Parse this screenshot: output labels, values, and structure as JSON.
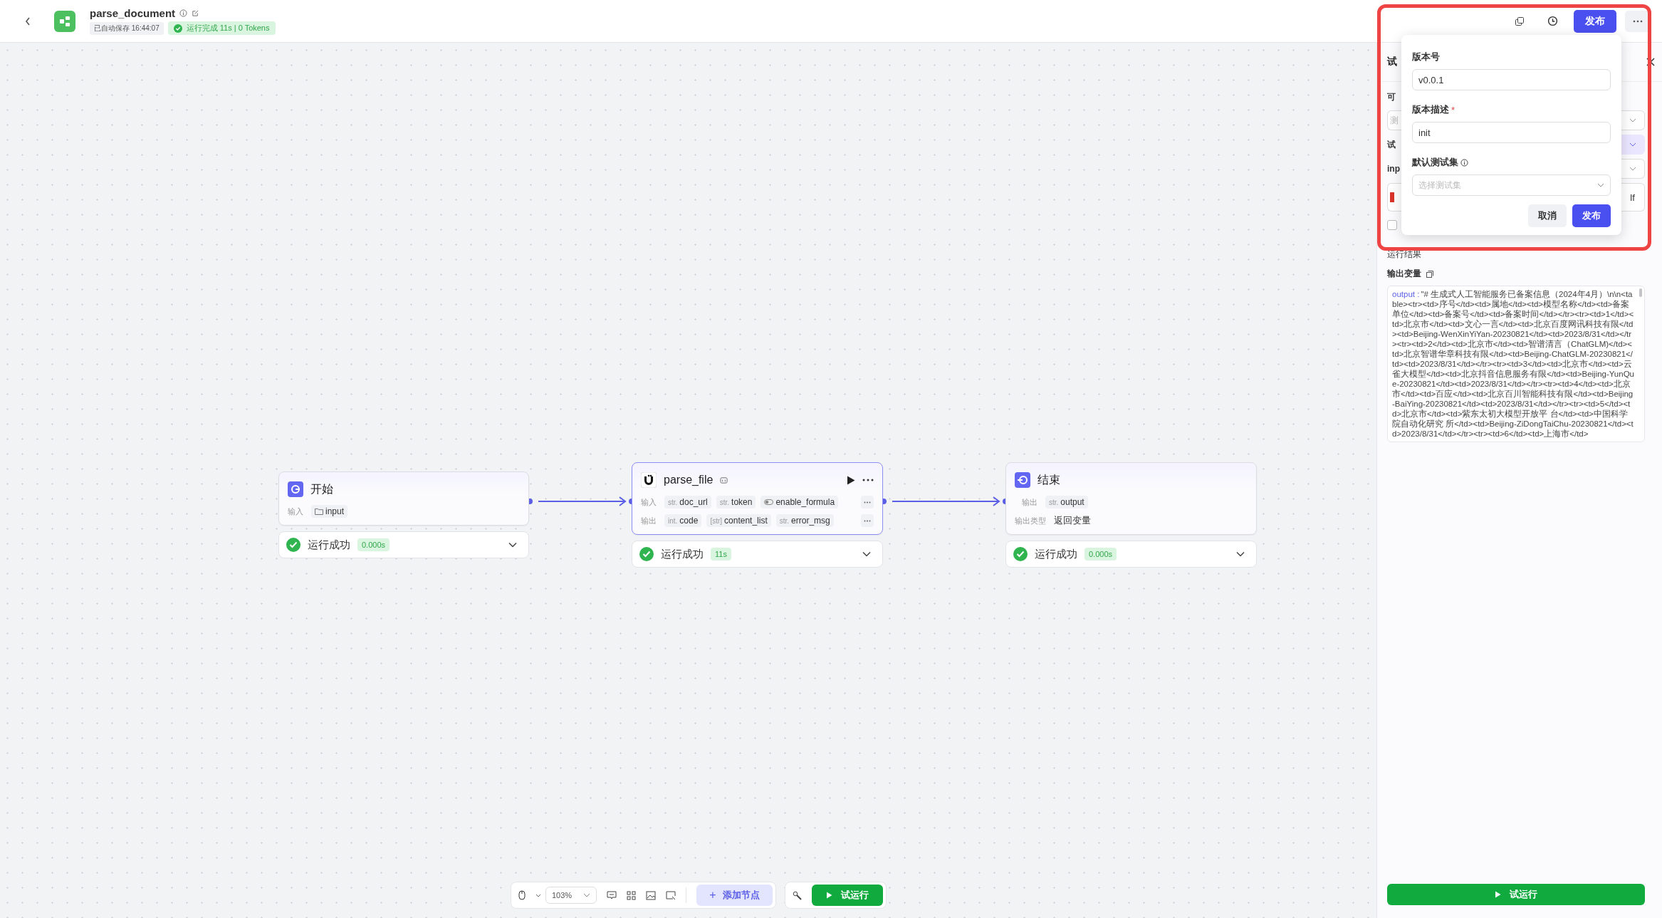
{
  "header": {
    "title": "parse_document",
    "autosave": "已自动保存 16:44:07",
    "run_status": "运行完成 11s | 0 Tokens",
    "publish": "发布"
  },
  "nodes": [
    {
      "kind": "start",
      "title": "开始",
      "selected": false,
      "rows": [
        {
          "label": "输入",
          "vars": [
            {
              "kind": "folder",
              "name": "input"
            }
          ]
        }
      ],
      "status": {
        "label": "运行成功",
        "time": "0.000s",
        "success": true
      }
    },
    {
      "kind": "tool",
      "title": "parse_file",
      "selected": true,
      "rows": [
        {
          "label": "输入",
          "vars": [
            {
              "kind": "typed",
              "type": "str.",
              "name": "doc_url"
            },
            {
              "kind": "typed",
              "type": "str.",
              "name": "token"
            },
            {
              "kind": "toggle",
              "name": "enable_formula"
            }
          ]
        },
        {
          "label": "输出",
          "vars": [
            {
              "kind": "typed",
              "type": "int.",
              "name": "code"
            },
            {
              "kind": "typed",
              "type": "[str]",
              "name": "content_list"
            },
            {
              "kind": "typed",
              "type": "str.",
              "name": "error_msg"
            }
          ]
        }
      ],
      "status": {
        "label": "运行成功",
        "time": "11s",
        "success": true
      }
    },
    {
      "kind": "end",
      "title": "结束",
      "selected": false,
      "rows": [
        {
          "label": "输出",
          "vars": [
            {
              "kind": "typed",
              "type": "str.",
              "name": "output"
            }
          ]
        }
      ],
      "output_type": {
        "label": "输出类型",
        "value": "返回变量"
      },
      "status": {
        "label": "运行成功",
        "time": "0.000s",
        "success": true
      }
    }
  ],
  "toolbar": {
    "zoom": "103%",
    "add_node": "添加节点",
    "plus": "+",
    "run": "试运行"
  },
  "panel": {
    "title": "试",
    "fragment_1": "可",
    "select_placeholder": "测",
    "fragment_2": "试",
    "fragment_3": "inp",
    "file_fragment": "lf",
    "checked": false,
    "result_title": "运行结果",
    "output_title": "输出变量",
    "output_key": "output :",
    "output_value": "\"# 生成式人工智能服务已备案信息（2024年4月）\\n\\n<table><tr><td>序号</td><td>属地</td><td>模型名称</td><td>备案单位</td><td>备案号</td><td>备案时间</td></tr><tr><td>1</td><td>北京市</td><td>文心一言</td><td>北京百度网讯科技有限</td><td>Beijing-WenXinYiYan-20230821</td><td>2023/8/31</td></tr><tr><td>2</td><td>北京市</td><td>智谱清言（ChatGLM)</td><td>北京智谱华章科技有限</td><td>Beijing-ChatGLM-20230821</td><td>2023/8/31</td></tr><tr><td>3</td><td>北京市</td><td>云雀大模型</td><td>北京抖音信息服务有限</td><td>Beijing-YunQue-20230821</td><td>2023/8/31</td></tr><tr><td>4</td><td>北京市</td><td>百应</td><td>北京百川智能科技有限</td><td>Beijing-BaiYing-20230821</td><td>2023/8/31</td></tr><tr><td>5</td><td>北京市</td><td>紫东太初大模型开放平 台</td><td>中国科学院自动化研究 所</td><td>Beijing-ZiDongTaiChu-20230821</td><td>2023/8/31</td></tr><tr><td>6</td><td>上海市</td>",
    "run_button": "试运行"
  },
  "publish_popup": {
    "version_label": "版本号",
    "version_value": "v0.0.1",
    "desc_label": "版本描述",
    "required_mark": "*",
    "desc_value": "init",
    "testset_label": "默认测试集",
    "testset_placeholder": "选择测试集",
    "cancel": "取消",
    "confirm": "发布"
  }
}
